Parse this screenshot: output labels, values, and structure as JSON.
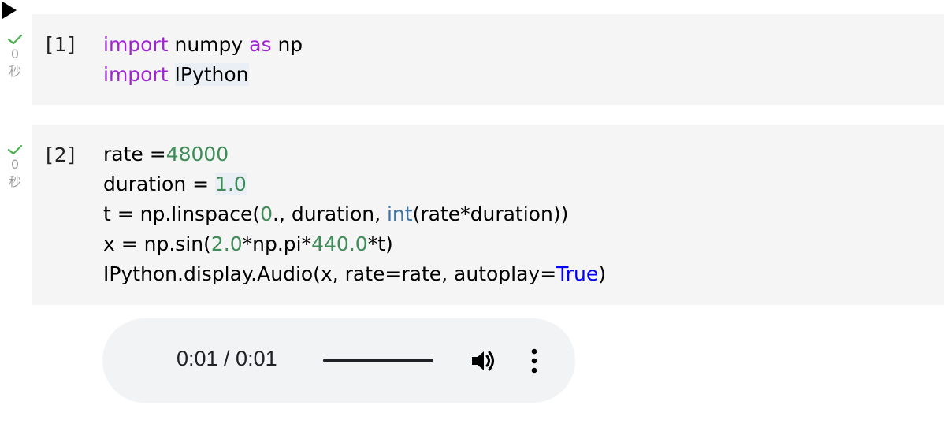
{
  "cells": [
    {
      "status": {
        "seconds": "0",
        "unit": "秒"
      },
      "prompt": "[1]",
      "lines": [
        [
          {
            "t": "import",
            "c": "kw"
          },
          {
            "t": " numpy ",
            "c": ""
          },
          {
            "t": "as",
            "c": "kw"
          },
          {
            "t": " np",
            "c": ""
          }
        ],
        [
          {
            "t": "import",
            "c": "kw"
          },
          {
            "t": " ",
            "c": ""
          },
          {
            "t": "IPython",
            "c": "hl"
          }
        ]
      ]
    },
    {
      "status": {
        "seconds": "0",
        "unit": "秒"
      },
      "prompt": "[2]",
      "lines": [
        [
          {
            "t": "rate =",
            "c": ""
          },
          {
            "t": "48000",
            "c": "num"
          }
        ],
        [
          {
            "t": "duration = ",
            "c": ""
          },
          {
            "t": "1.0",
            "c": "num hl"
          }
        ],
        [
          {
            "t": "t = np.linspace(",
            "c": ""
          },
          {
            "t": "0",
            "c": "num"
          },
          {
            "t": "., duration, ",
            "c": ""
          },
          {
            "t": "int",
            "c": "bi"
          },
          {
            "t": "(rate*duration))",
            "c": ""
          }
        ],
        [
          {
            "t": "x = np.sin(",
            "c": ""
          },
          {
            "t": "2.0",
            "c": "num"
          },
          {
            "t": "*np.pi*",
            "c": ""
          },
          {
            "t": "440.0",
            "c": "num"
          },
          {
            "t": "*t)",
            "c": ""
          }
        ],
        [
          {
            "t": "IPython.display.Audio(x, rate=rate, autoplay=",
            "c": ""
          },
          {
            "t": "True",
            "c": "bool"
          },
          {
            "t": ")",
            "c": ""
          }
        ]
      ]
    }
  ],
  "audio": {
    "time": "0:01 / 0:01",
    "progress": 1.0,
    "icons": [
      "play-icon",
      "volume-icon",
      "more-vert-icon"
    ]
  },
  "colors": {
    "keyword": "#a024d2",
    "number": "#3f8c59",
    "builtin": "#3f74a4",
    "boolean": "#0000ff",
    "check": "#4caf50"
  }
}
